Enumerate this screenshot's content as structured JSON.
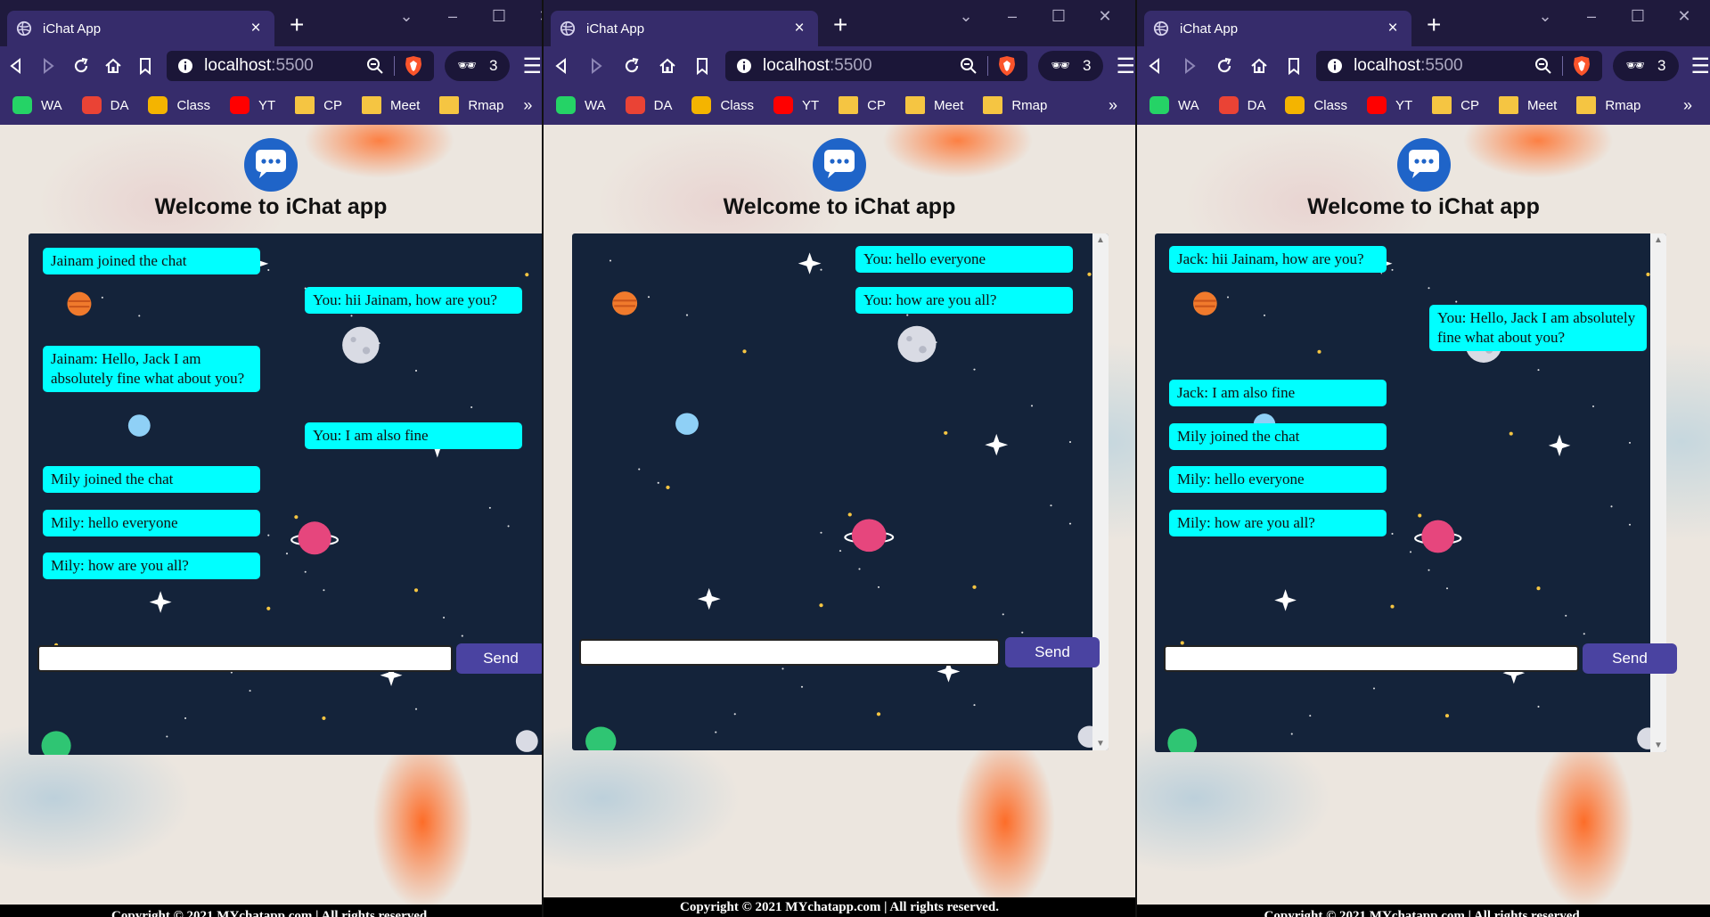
{
  "browser": {
    "tab_title": "iChat App",
    "tab_close": "×",
    "new_tab": "+",
    "url_host": "localhost",
    "url_port": ":5500",
    "extension_count": "3",
    "bookmarks": [
      "WA",
      "DA",
      "Class",
      "YT",
      "CP",
      "Meet",
      "Rmap"
    ],
    "bookmarks_more": "»",
    "menu": "☰"
  },
  "colors": {
    "browser_frame": "#362c6b",
    "chat_bg": "#14233a",
    "message_bubble": "#00ffff",
    "send_button": "#4a43a1",
    "footer": "#000000"
  },
  "app": {
    "heading": "Welcome to iChat app",
    "send_label": "Send",
    "footer": "Copyright © 2021 MYchatapp.com | All rights reserved."
  },
  "windows": [
    {
      "messages": [
        {
          "side": "left",
          "text": "Jainam joined the chat"
        },
        {
          "side": "right",
          "text": "You: hii Jainam, how are you?"
        },
        {
          "side": "left",
          "text": "Jainam: Hello, Jack I am absolutely fine what about you?"
        },
        {
          "side": "right",
          "text": "You: I am also fine"
        },
        {
          "side": "left",
          "text": "Mily joined the chat"
        },
        {
          "side": "left",
          "text": "Mily: hello everyone"
        },
        {
          "side": "left",
          "text": "Mily: how are you all?"
        }
      ]
    },
    {
      "messages": [
        {
          "side": "right",
          "text": "You: hello everyone"
        },
        {
          "side": "right",
          "text": "You: how are you all?"
        }
      ]
    },
    {
      "messages": [
        {
          "side": "left",
          "text": "Jack: hii Jainam, how are you?"
        },
        {
          "side": "right",
          "text": "You: Hello, Jack I am absolutely fine what about you?"
        },
        {
          "side": "left",
          "text": "Jack: I am also fine"
        },
        {
          "side": "left",
          "text": "Mily joined the chat"
        },
        {
          "side": "left",
          "text": "Mily: hello everyone"
        },
        {
          "side": "left",
          "text": "Mily: how are you all?"
        }
      ]
    }
  ]
}
